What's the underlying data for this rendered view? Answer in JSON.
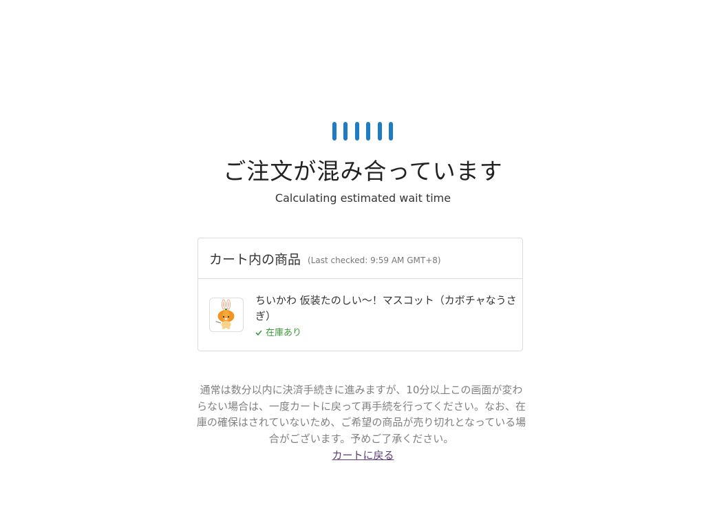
{
  "loader": {
    "bar_count": 6,
    "color": "#1f7ac7"
  },
  "title": "ご注文が混み合っています",
  "subtitle": "Calculating estimated wait time",
  "cart": {
    "heading": "カート内の商品",
    "last_checked": "(Last checked: 9:59 AM GMT+8)",
    "items": [
      {
        "name": "ちいかわ 仮装たのしい〜！マスコット（カボチャなうさぎ）",
        "thumbnail_icon": "pumpkin-rabbit-mascot-icon",
        "stock_icon": "check-icon",
        "stock_label": "在庫あり"
      }
    ]
  },
  "notice": {
    "text": "通常は数分以内に決済手続きに進みますが、10分以上この画面が変わらない場合は、一度カートに戻って再手続を行ってください。なお、在庫の確保はされていないため、ご希望の商品が売り切れとなっている場合がございます。予めご了承ください。"
  },
  "back_link_label": "カートに戻る",
  "colors": {
    "accent": "#1f7ac7",
    "in_stock": "#3a9a3a",
    "link": "#5a3a7a"
  }
}
